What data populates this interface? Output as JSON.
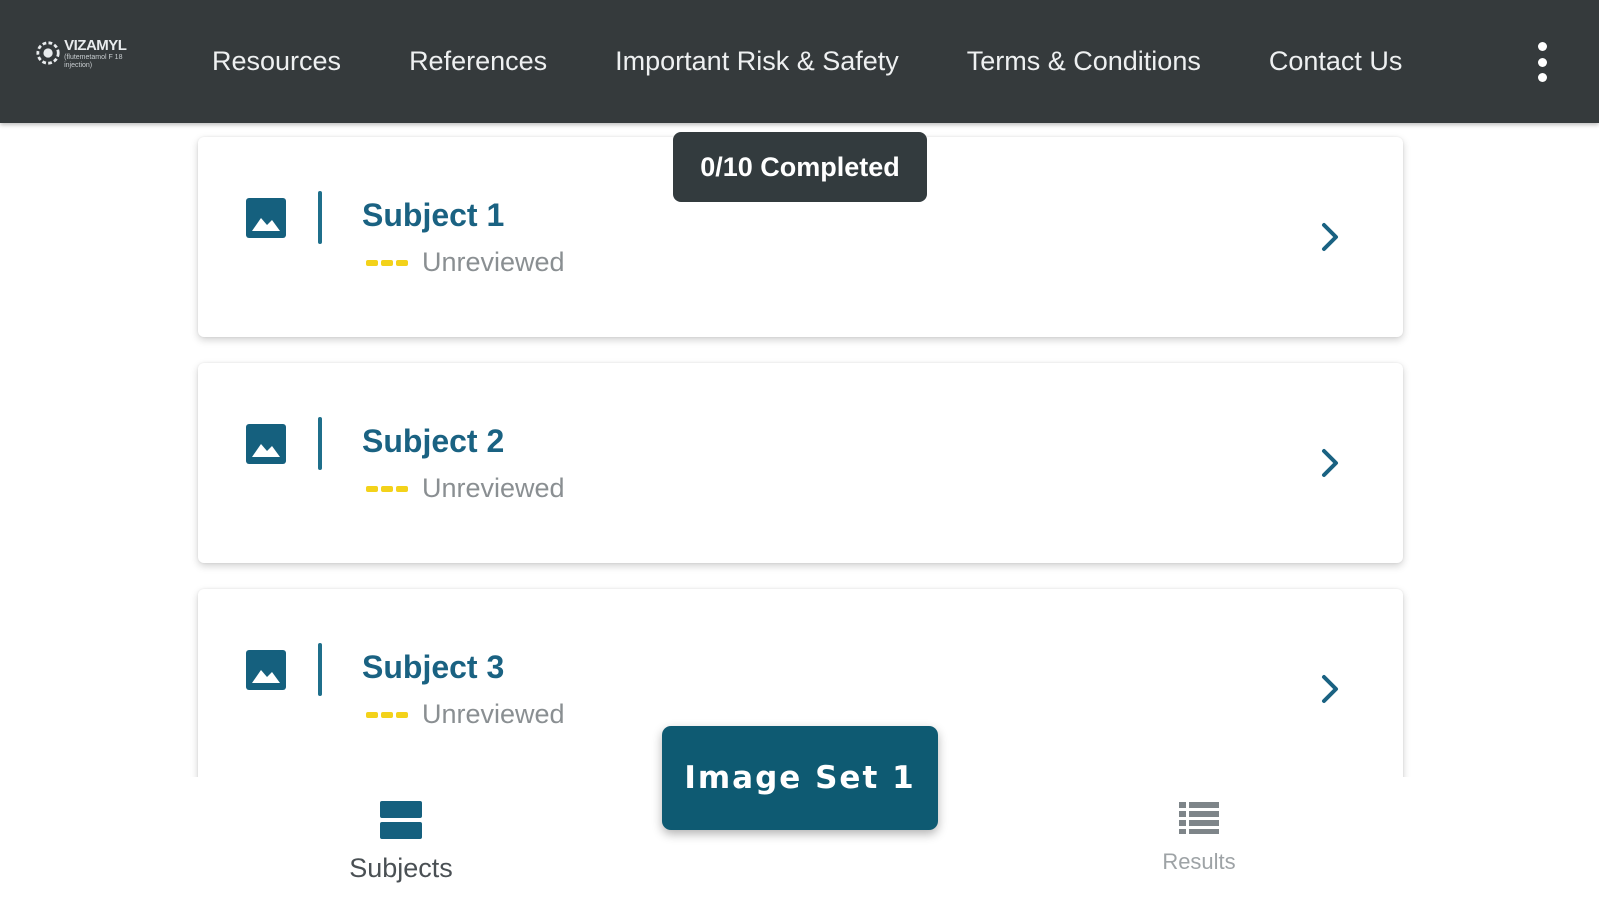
{
  "header": {
    "logo": {
      "name": "VIZAMYL",
      "subtitle": "(flutemetamol F 18 injection)"
    },
    "nav": [
      {
        "label": "Resources"
      },
      {
        "label": "References"
      },
      {
        "label": "Important Risk & Safety"
      },
      {
        "label": "Terms & Conditions"
      },
      {
        "label": "Contact Us"
      }
    ],
    "menu_icon": "kebab-menu-icon"
  },
  "progress": {
    "label": "0/10 Completed"
  },
  "subjects": [
    {
      "title": "Subject 1",
      "status": "Unreviewed",
      "icon": "image-icon"
    },
    {
      "title": "Subject 2",
      "status": "Unreviewed",
      "icon": "image-icon"
    },
    {
      "title": "Subject 3",
      "status": "Unreviewed",
      "icon": "image-icon"
    }
  ],
  "fab": {
    "label": "Image Set 1"
  },
  "bottom_nav": {
    "subjects_label": "Subjects",
    "results_label": "Results",
    "active": "Subjects"
  },
  "colors": {
    "header_bg": "#353a3c",
    "accent": "#1a6282",
    "button_bg": "#0e5a72",
    "status_yellow": "#f3d21a"
  }
}
